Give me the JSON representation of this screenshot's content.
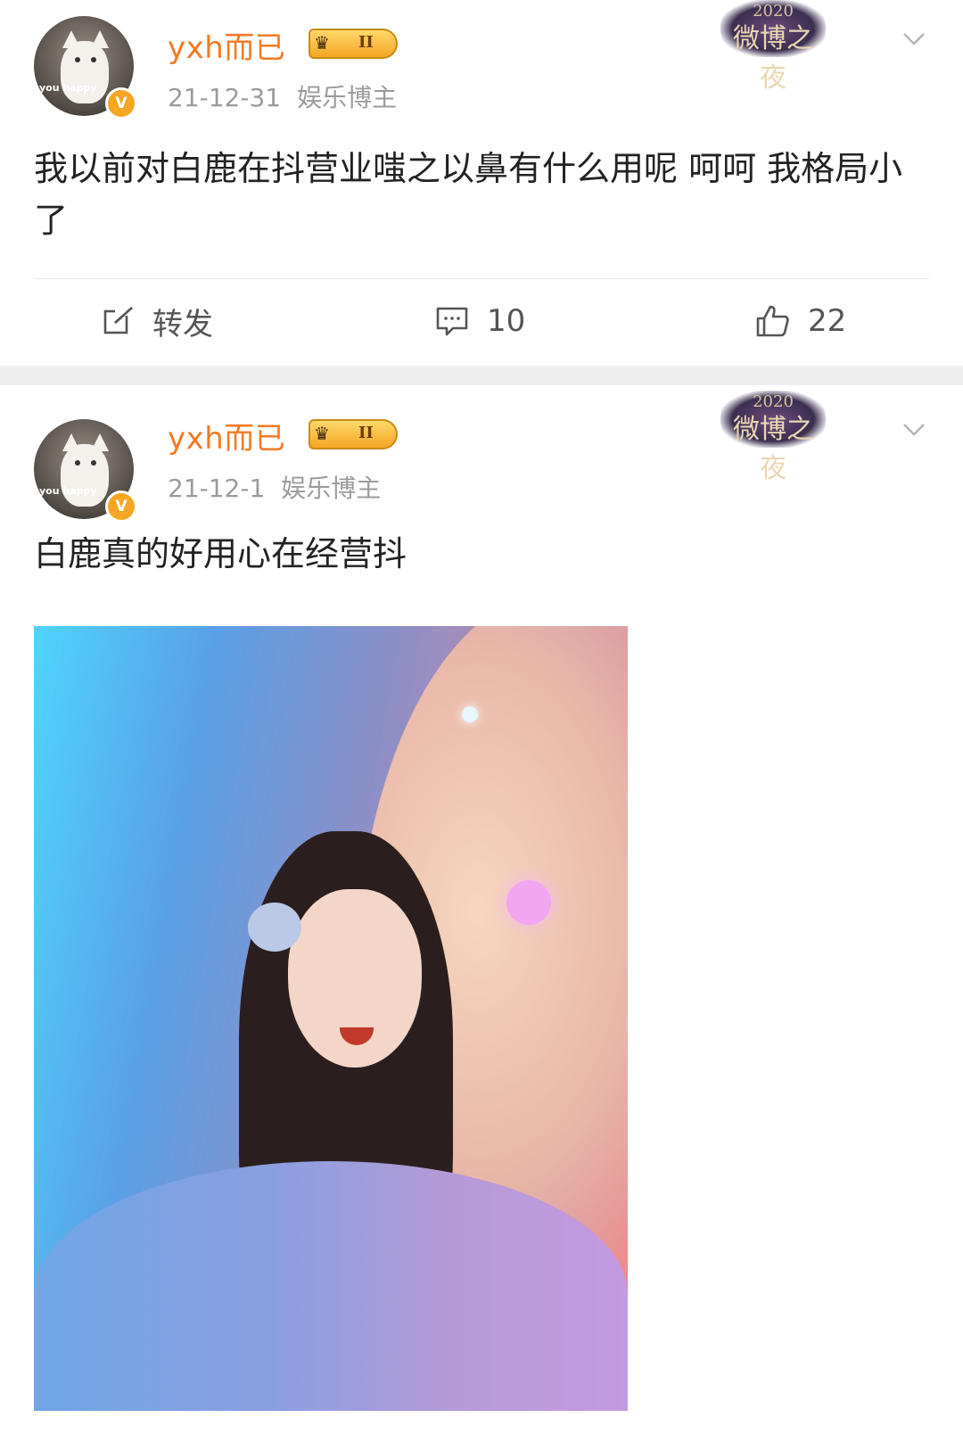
{
  "posts": [
    {
      "username": "yxh而已",
      "crown_level": "II",
      "date": "21-12-31",
      "category": "娱乐博主",
      "event_badge": {
        "year": "2020",
        "name": "微博之夜"
      },
      "text": "我以前对白鹿在抖营业嗤之以鼻有什么用呢 呵呵 我格局小了",
      "actions": {
        "repost_label": "转发",
        "comments": "10",
        "likes": "22"
      }
    },
    {
      "username": "yxh而已",
      "crown_level": "II",
      "date": "21-12-1",
      "category": "娱乐博主",
      "event_badge": {
        "year": "2020",
        "name": "微博之夜"
      },
      "text": "白鹿真的好用心在经营抖"
    }
  ],
  "avatar_caption": "you happy",
  "colors": {
    "username": "#f57a23",
    "meta": "#9b9b9b",
    "verified_badge": "#f6a623",
    "separator": "#eeeeee"
  }
}
